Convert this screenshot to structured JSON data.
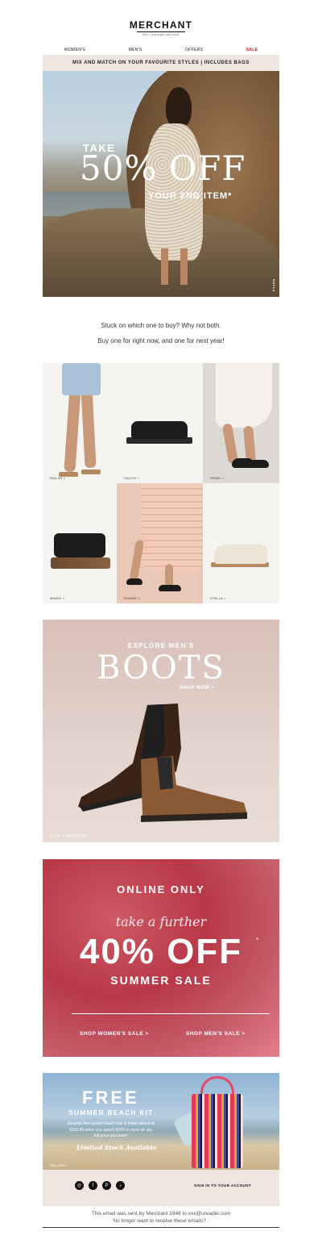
{
  "header": {
    "logo": "MERCHANT",
    "tagline": "EST. 1948 NEW ZEALAND"
  },
  "nav": {
    "items": [
      "WOMEN'S",
      "MEN'S",
      "OFFERS",
      "SALE"
    ]
  },
  "promo_bar": "MIX AND MATCH ON YOUR FAVOURITE STYLES | INCLUDES BAGS",
  "hero": {
    "take": "TAKE",
    "headline": "50% OFF",
    "sub": "YOUR 2ND ITEM*",
    "credit": "NAYLA"
  },
  "copy": {
    "line1": "Stuck on which one to buy? Why not both.",
    "line2": "Buy one for right now, and one for next year!"
  },
  "products": [
    "RAILAN >",
    "CALVIN >",
    "PEARL >",
    "MINGO >",
    "ROBBIE >",
    "STELLA >"
  ],
  "boots": {
    "explore": "EXPLORE MEN'S",
    "title": "BOOTS",
    "shop": "SHOP NOW >",
    "credit": "KYLE & BRENDON"
  },
  "sale": {
    "only": "ONLINE ONLY",
    "further": "take a further",
    "percent": "40% OFF",
    "asterisk": "*",
    "summer": "SUMMER SALE",
    "womens_btn": "SHOP WOMEN'S SALE >",
    "mens_btn": "SHOP MEN'S SALE >"
  },
  "kit": {
    "free": "FREE",
    "name": "SUMMER BEACH KIT",
    "desc": "Receive free woven beach tote & towel valued at $169.80 when you spend $249 or more on any full price purchase*",
    "limited": "Limited Stock Available",
    "tcs": "*T&Cs APPLY"
  },
  "footer": {
    "social": [
      "instagram-icon",
      "facebook-icon",
      "pinterest-icon",
      "tiktok-icon"
    ],
    "signin": "SIGN IN TO YOUR ACCOUNT",
    "sent": "This email was sent by Merchant 1948 to xxx@ureader.com",
    "unsub": "No longer want to receive these emails? ."
  },
  "colors": {
    "sale_red": "#d0212a",
    "bar_bg": "#efe6e2"
  }
}
